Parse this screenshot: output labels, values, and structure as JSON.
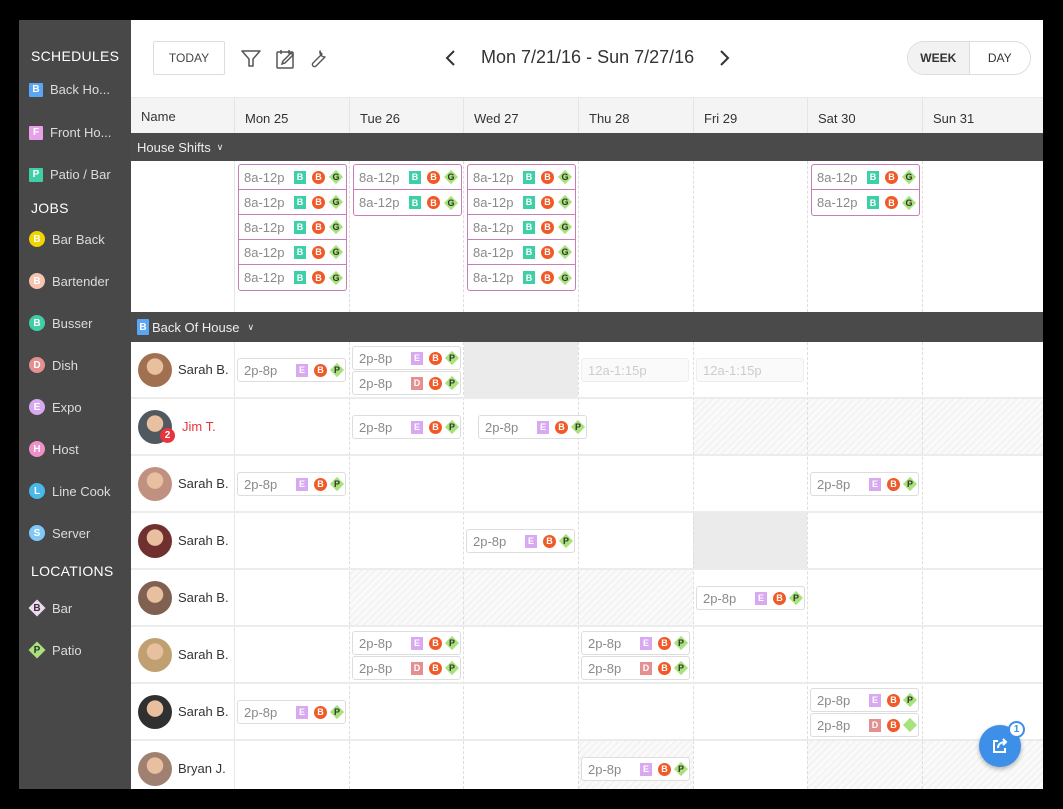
{
  "sidebar": {
    "schedules_heading": "SCHEDULES",
    "schedules": [
      {
        "letter": "B",
        "label": "Back Ho...",
        "color": "#5aa5f5"
      },
      {
        "letter": "F",
        "label": "Front Ho...",
        "color": "#e8a0e8"
      },
      {
        "letter": "P",
        "label": "Patio / Bar",
        "color": "#3ecfa8"
      }
    ],
    "jobs_heading": "JOBS",
    "jobs": [
      {
        "letter": "B",
        "label": "Bar Back",
        "color": "#f2d400"
      },
      {
        "letter": "B",
        "label": "Bartender",
        "color": "#f8c4b0"
      },
      {
        "letter": "B",
        "label": "Busser",
        "color": "#3ecfa8"
      },
      {
        "letter": "D",
        "label": "Dish",
        "color": "#e49090"
      },
      {
        "letter": "E",
        "label": "Expo",
        "color": "#d8a8f0"
      },
      {
        "letter": "H",
        "label": "Host",
        "color": "#f090c8"
      },
      {
        "letter": "L",
        "label": "Line Cook",
        "color": "#4ab8e8"
      },
      {
        "letter": "S",
        "label": "Server",
        "color": "#80c8f8"
      }
    ],
    "locations_heading": "LOCATIONS",
    "locations": [
      {
        "letter": "B",
        "label": "Bar",
        "color": "#f0d8f0"
      },
      {
        "letter": "P",
        "label": "Patio",
        "color": "#a8e27a"
      }
    ]
  },
  "toolbar": {
    "today_label": "TODAY",
    "filter_icon": "filter-icon",
    "edit_calendar_icon": "calendar-edit-icon",
    "settings_icon": "wrench-icon",
    "date_range": "Mon 7/21/16 - Sun 7/27/16",
    "view_week": "WEEK",
    "view_day": "DAY",
    "active_view": "WEEK"
  },
  "grid": {
    "name_header": "Name",
    "days": [
      "Mon 25",
      "Tue 26",
      "Wed 27",
      "Thu 28",
      "Fri 29",
      "Sat 30",
      "Sun 31"
    ]
  },
  "house_shifts": {
    "title": "House Shifts",
    "shift_time": "8a-12p",
    "tags": [
      "B",
      "B",
      "G"
    ],
    "counts_per_day": [
      5,
      2,
      5,
      0,
      0,
      2,
      0
    ]
  },
  "back_of_house": {
    "badge": "B",
    "title": "Back Of House",
    "employees": [
      {
        "name": "Sarah B.",
        "alert": false,
        "badge_count": null
      },
      {
        "name": "Jim T.",
        "alert": true,
        "badge_count": "2"
      },
      {
        "name": "Sarah B.",
        "alert": false,
        "badge_count": null
      },
      {
        "name": "Sarah B.",
        "alert": false,
        "badge_count": null
      },
      {
        "name": "Sarah B.",
        "alert": false,
        "badge_count": null
      },
      {
        "name": "Sarah B.",
        "alert": false,
        "badge_count": null
      },
      {
        "name": "Sarah B.",
        "alert": false,
        "badge_count": null
      },
      {
        "name": "Bryan J.",
        "alert": false,
        "badge_count": null
      }
    ],
    "shift_time": "2p-8p",
    "unavailable_time": "12a-1:15p",
    "job_tags": {
      "E": "#d8a8f0",
      "D": "#e49090"
    },
    "location_tag": "P"
  },
  "fab": {
    "icon": "share-icon",
    "badge": "1"
  }
}
